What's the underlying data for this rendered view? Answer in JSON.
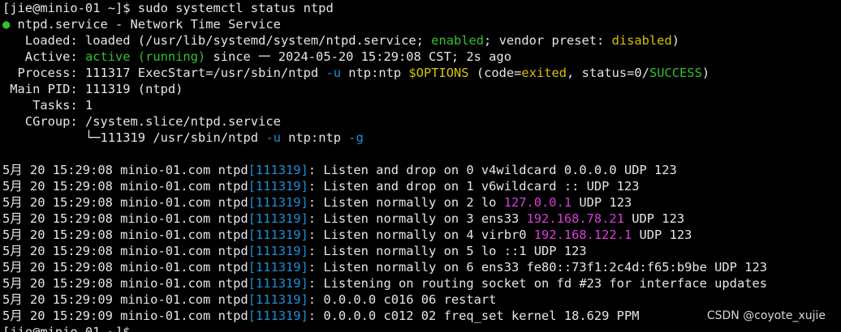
{
  "colors": {
    "background": "#000000",
    "text": "#e6e6e6",
    "green": "#2fc22f",
    "yellow": "#d6c400",
    "blue": "#1a8fd8",
    "magenta": "#d440d4"
  },
  "prompt": {
    "prefix": "[jie@minio-01 ~]$ ",
    "command": "sudo systemctl status ntpd"
  },
  "status": {
    "dot": "●",
    "unit": " ntpd.service - Network Time Service",
    "loaded_label": "   Loaded: ",
    "loaded_pre": "loaded (/usr/lib/systemd/system/ntpd.service; ",
    "loaded_enabled": "enabled",
    "loaded_mid": "; vendor preset: ",
    "loaded_disabled": "disabled",
    "loaded_post": ")",
    "active_label": "   Active: ",
    "active_state": "active (running)",
    "active_post": " since 一 2024-05-20 15:29:08 CST; 2s ago",
    "process_label": "  Process: ",
    "process_pre": "111317 ExecStart=/usr/sbin/ntpd ",
    "process_flag": "-u",
    "process_mid": " ntp:ntp ",
    "process_var": "$OPTIONS",
    "process_code_pre": " (code=",
    "process_code": "exited",
    "process_status_pre": ", status=0/",
    "process_status": "SUCCESS",
    "process_post": ")",
    "mainpid_label": " Main PID: ",
    "mainpid_value": "111319 (ntpd)",
    "tasks_label": "    Tasks: ",
    "tasks_value": "1",
    "cgroup_label": "   CGroup: ",
    "cgroup_value": "/system.slice/ntpd.service",
    "cgroup_tree_pre": "           └─111319 /usr/sbin/ntpd ",
    "cgroup_tree_flag1": "-u",
    "cgroup_tree_mid": " ntp:ntp ",
    "cgroup_tree_flag2": "-g"
  },
  "logs": [
    {
      "prefix": "5月 20 15:29:08 minio-01.com ntpd",
      "pid": "[111319]",
      "msg_pre": ": Listen and drop on 0 v4wildcard 0.0.0.0 UDP 123",
      "ip": "",
      "msg_post": ""
    },
    {
      "prefix": "5月 20 15:29:08 minio-01.com ntpd",
      "pid": "[111319]",
      "msg_pre": ": Listen and drop on 1 v6wildcard :: UDP 123",
      "ip": "",
      "msg_post": ""
    },
    {
      "prefix": "5月 20 15:29:08 minio-01.com ntpd",
      "pid": "[111319]",
      "msg_pre": ": Listen normally on 2 lo ",
      "ip": "127.0.0.1",
      "msg_post": " UDP 123"
    },
    {
      "prefix": "5月 20 15:29:08 minio-01.com ntpd",
      "pid": "[111319]",
      "msg_pre": ": Listen normally on 3 ens33 ",
      "ip": "192.168.78.21",
      "msg_post": " UDP 123"
    },
    {
      "prefix": "5月 20 15:29:08 minio-01.com ntpd",
      "pid": "[111319]",
      "msg_pre": ": Listen normally on 4 virbr0 ",
      "ip": "192.168.122.1",
      "msg_post": " UDP 123"
    },
    {
      "prefix": "5月 20 15:29:08 minio-01.com ntpd",
      "pid": "[111319]",
      "msg_pre": ": Listen normally on 5 lo ::1 UDP 123",
      "ip": "",
      "msg_post": ""
    },
    {
      "prefix": "5月 20 15:29:08 minio-01.com ntpd",
      "pid": "[111319]",
      "msg_pre": ": Listen normally on 6 ens33 fe80::73f1:2c4d:f65:b9be UDP 123",
      "ip": "",
      "msg_post": ""
    },
    {
      "prefix": "5月 20 15:29:08 minio-01.com ntpd",
      "pid": "[111319]",
      "msg_pre": ": Listening on routing socket on fd #23 for interface updates",
      "ip": "",
      "msg_post": ""
    },
    {
      "prefix": "5月 20 15:29:09 minio-01.com ntpd",
      "pid": "[111319]",
      "msg_pre": ": 0.0.0.0 c016 06 restart",
      "ip": "",
      "msg_post": ""
    },
    {
      "prefix": "5月 20 15:29:09 minio-01.com ntpd",
      "pid": "[111319]",
      "msg_pre": ": 0.0.0.0 c012 02 freq_set kernel 18.629 PPM",
      "ip": "",
      "msg_post": ""
    }
  ],
  "watermark": "CSDN @coyote_xujie"
}
